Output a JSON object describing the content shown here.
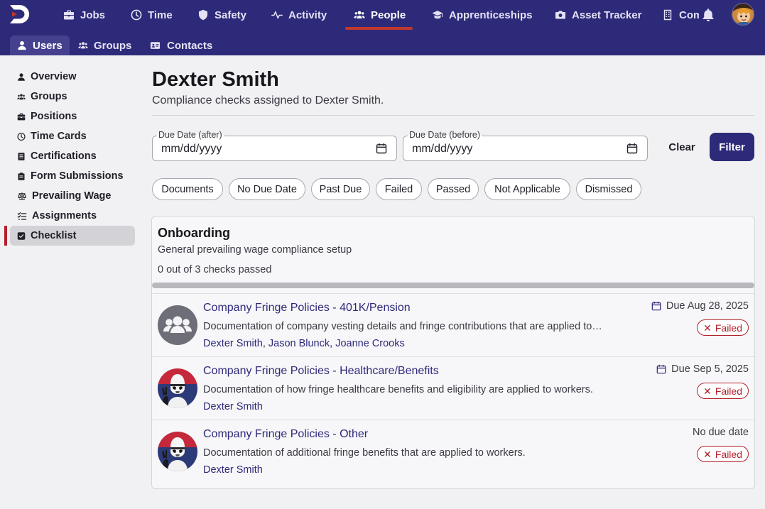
{
  "colors": {
    "brand": "#2e2a7a",
    "accent_red": "#b3202a",
    "background": "#f1f0f2"
  },
  "top_nav": {
    "items": [
      {
        "label": "Jobs",
        "icon": "briefcase-icon"
      },
      {
        "label": "Time",
        "icon": "clock-icon"
      },
      {
        "label": "Safety",
        "icon": "shield-icon"
      },
      {
        "label": "Activity",
        "icon": "pulse-icon"
      },
      {
        "label": "People",
        "icon": "users-icon",
        "active": true
      },
      {
        "label": "Apprenticeships",
        "icon": "graduation-cap-icon"
      },
      {
        "label": "Asset Tracker",
        "icon": "camera-icon"
      },
      {
        "label": "Com",
        "icon": "building-icon"
      }
    ]
  },
  "sub_nav": {
    "items": [
      {
        "label": "Users",
        "icon": "user-icon",
        "active": true
      },
      {
        "label": "Groups",
        "icon": "users-icon"
      },
      {
        "label": "Contacts",
        "icon": "id-card-icon"
      }
    ]
  },
  "sidebar": {
    "items": [
      {
        "label": "Overview",
        "icon": "user-icon"
      },
      {
        "label": "Groups",
        "icon": "users-icon"
      },
      {
        "label": "Positions",
        "icon": "briefcase-icon"
      },
      {
        "label": "Time Cards",
        "icon": "clock-icon"
      },
      {
        "label": "Certifications",
        "icon": "document-icon"
      },
      {
        "label": "Form Submissions",
        "icon": "clipboard-icon"
      },
      {
        "label": "Prevailing Wage",
        "icon": "scale-icon"
      },
      {
        "label": "Assignments",
        "icon": "list-check-icon"
      },
      {
        "label": "Checklist",
        "icon": "square-check-icon",
        "active": true
      }
    ]
  },
  "header": {
    "title": "Dexter Smith",
    "subtitle": "Compliance checks assigned to Dexter Smith."
  },
  "filters": {
    "due_after_label": "Due Date (after)",
    "due_after_value": "mm/dd/yyyy",
    "due_before_label": "Due Date (before)",
    "due_before_value": "mm/dd/yyyy",
    "clear_label": "Clear",
    "filter_label": "Filter",
    "chips": [
      "Documents",
      "No Due Date",
      "Past Due",
      "Failed",
      "Passed",
      "Not Applicable",
      "Dismissed"
    ]
  },
  "checklist_group": {
    "title": "Onboarding",
    "description": "General prevailing wage compliance setup",
    "progress_text": "0 out of 3 checks passed",
    "progress_fraction": 0,
    "checks": [
      {
        "title": "Company Fringe Policies - 401K/Pension",
        "description": "Documentation of company vesting details and fringe contributions that are applied to…",
        "people": [
          "Dexter Smith",
          "Jason Blunck",
          "Joanne Crooks"
        ],
        "due": "Due Aug 28, 2025",
        "has_due_icon": true,
        "status": "Failed",
        "avatar": "group-avatar-icon"
      },
      {
        "title": "Company Fringe Policies - Healthcare/Benefits",
        "description": "Documentation of how fringe healthcare benefits and eligibility are applied to workers.",
        "people": [
          "Dexter Smith"
        ],
        "due": "Due Sep 5, 2025",
        "has_due_icon": true,
        "status": "Failed",
        "avatar": "stormtrooper-avatar"
      },
      {
        "title": "Company Fringe Policies - Other",
        "description": "Documentation of additional fringe benefits that are applied to workers.",
        "people": [
          "Dexter Smith"
        ],
        "due": "No due date",
        "has_due_icon": false,
        "status": "Failed",
        "avatar": "stormtrooper-avatar"
      }
    ]
  }
}
